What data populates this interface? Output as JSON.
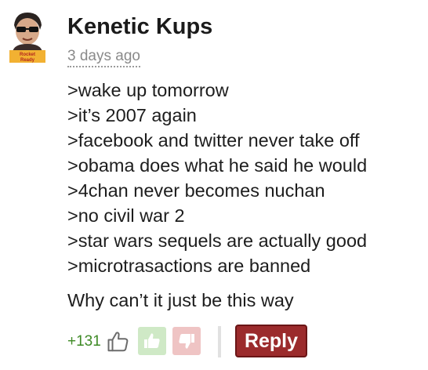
{
  "comment": {
    "author": "Kenetic Kups",
    "timestamp": "3 days ago",
    "avatar_badge_text": "Rocket Ready",
    "lines": [
      ">wake up tomorrow",
      ">it’s 2007 again",
      ">facebook and twitter never take off",
      ">obama does what he said he would",
      ">4chan never becomes nuchan",
      ">no civil war 2",
      ">star wars sequels are actually good",
      ">microtrasactions are banned"
    ],
    "closing": "Why can’t it just be this way"
  },
  "actions": {
    "score": "+131",
    "upvote_icon": "thumbs-up-icon",
    "downvote_icon": "thumbs-down-icon",
    "reply_label": "Reply"
  },
  "colors": {
    "score": "#3e8a25",
    "upvote_bg": "#cfe9c6",
    "downvote_bg": "#efc4c4",
    "reply_bg": "#9b2b2c",
    "timestamp": "#8a8a8a"
  }
}
